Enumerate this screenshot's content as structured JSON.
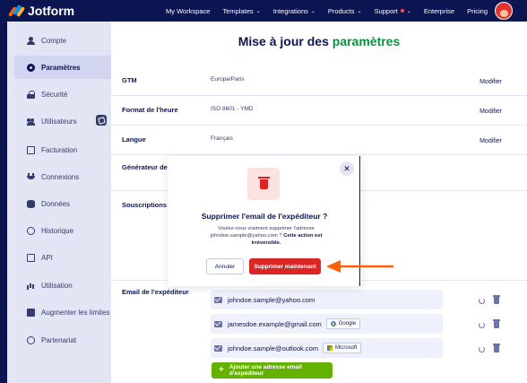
{
  "brand": {
    "name": "Jotform"
  },
  "nav": {
    "items": [
      {
        "label": "My Workspace",
        "caret": false
      },
      {
        "label": "Templates",
        "caret": true
      },
      {
        "label": "Integrations",
        "caret": true
      },
      {
        "label": "Products",
        "caret": true
      },
      {
        "label": "Support",
        "caret": true
      },
      {
        "label": "Enterprise",
        "caret": false
      },
      {
        "label": "Pricing",
        "caret": false
      }
    ]
  },
  "sidebar": {
    "items": [
      {
        "label": "Compte",
        "icon": "user-icon"
      },
      {
        "label": "Paramètres",
        "icon": "gear-icon",
        "active": true
      },
      {
        "label": "Sécurité",
        "icon": "lock-icon"
      },
      {
        "label": "Utilisateurs",
        "icon": "users-icon"
      },
      {
        "label": "Facturation",
        "icon": "billing-icon"
      },
      {
        "label": "Connexions",
        "icon": "plug-icon"
      },
      {
        "label": "Données",
        "icon": "database-icon"
      },
      {
        "label": "Historique",
        "icon": "clock-icon"
      },
      {
        "label": "API",
        "icon": "api-icon"
      },
      {
        "label": "Utilisation",
        "icon": "bar-chart-icon"
      },
      {
        "label": "Augmenter les limites",
        "icon": "gift-icon"
      },
      {
        "label": "Partenariat",
        "icon": "handshake-icon"
      }
    ]
  },
  "page": {
    "title_prefix": "Mise à jour des ",
    "title_accent": "paramètres",
    "accent_color": "#0f8e3d"
  },
  "settings": {
    "gmt": {
      "label": "GTM",
      "value": "Europe/Paris",
      "action": "Modifier"
    },
    "time_format": {
      "label": "Format de l'heure",
      "value": "ISO 8601 - YMD",
      "action": "Modifier"
    },
    "language": {
      "label": "Langue",
      "value": "Français",
      "action": "Modifier"
    },
    "generator": {
      "label": "Générateur de f"
    },
    "subscriptions": {
      "label": "Souscriptions"
    },
    "sender_email": {
      "label": "Email de l'expéditeur"
    }
  },
  "senders": [
    {
      "email": "johndoe.sample@yahoo.com",
      "provider": ""
    },
    {
      "email": "jamesdoe.example@gmail.com",
      "provider": "Google"
    },
    {
      "email": "johndoe.sample@outlook.com",
      "provider": "Microsoft"
    }
  ],
  "add_sender_label": "Ajouter une adresse email d'expéditeur",
  "modal": {
    "title": "Supprimer l'email de l'expéditeur ?",
    "body_text": "Voulez-vous vraiment supprimer l'adresse johndoe.sample@yahoo.com ?",
    "body_bold": "Cette action est irréversible.",
    "cancel_label": "Annuler",
    "delete_label": "Supprimer maintenant",
    "close_glyph": "✕"
  },
  "colors": {
    "navy": "#0a1551",
    "delete_red": "#dc2626",
    "add_green": "#64b200",
    "arrow_orange": "#ff6100"
  }
}
